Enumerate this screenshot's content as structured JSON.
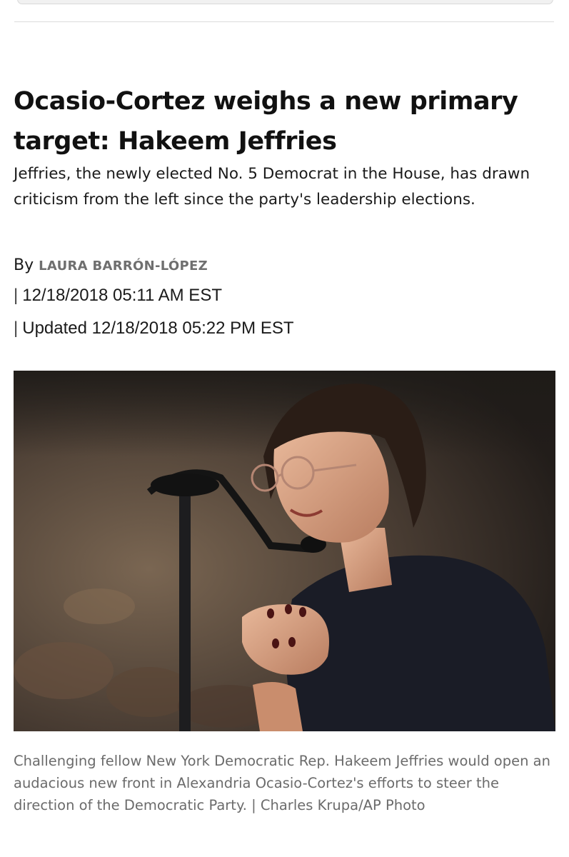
{
  "article": {
    "headline": "Ocasio-Cortez weighs a new primary target: Hakeem Jeffries",
    "dek": "Jeffries, the newly elected No. 5 Democrat in the House, has drawn criticism from the left since the party's leadership elections.",
    "byline_prefix": "By",
    "author": "LAURA BARRÓN-LÓPEZ",
    "separator": "|",
    "published": "12/18/2018 05:11 AM EST",
    "updated": "Updated 12/18/2018 05:22 PM EST"
  },
  "photo": {
    "caption": "Challenging fellow New York Democratic Rep. Hakeem Jeffries would open an audacious new front in Alexandria Ocasio-Cortez's efforts to steer the direction of the Democratic Party. | Charles Krupa/AP Photo"
  },
  "colors": {
    "headline": "#111111",
    "author": "#6f6f6f",
    "caption": "#6b6b6b",
    "rule": "#dcdcdc"
  }
}
